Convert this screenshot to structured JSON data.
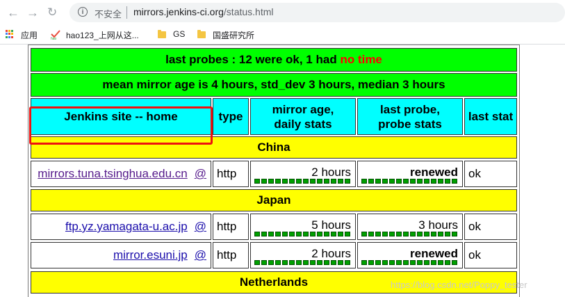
{
  "browser": {
    "insecure_label": "不安全",
    "url_host": "mirrors.jenkins-ci.org",
    "url_path": "/status.html",
    "bookmarks": [
      "应用",
      "hao123_上网从这...",
      "GS",
      "国盛研究所"
    ]
  },
  "summary": {
    "probes_prefix": "last probes : 12 were ok, 1 had ",
    "probes_highlight": "no time",
    "mean_age": "mean mirror age is 4 hours, std_dev 3 hours, median 3 hours"
  },
  "headers": {
    "site": "Jenkins site -- home",
    "type": "type",
    "age_line1": "mirror age,",
    "age_line2": "daily stats",
    "probe_line1": "last probe,",
    "probe_line2": "probe stats",
    "stat": "last stat"
  },
  "groups": {
    "china": "China",
    "japan": "Japan",
    "netherlands": "Netherlands"
  },
  "rows": [
    {
      "site": "mirrors.tuna.tsinghua.edu.cn",
      "at": "@",
      "type": "http",
      "age": "2 hours",
      "probe": "renewed",
      "stat": "ok"
    },
    {
      "site": "ftp.yz.yamagata-u.ac.jp",
      "at": "@",
      "type": "http",
      "age": "5 hours",
      "probe": "3 hours",
      "stat": "ok"
    },
    {
      "site": "mirror.esuni.jp",
      "at": "@",
      "type": "http",
      "age": "2 hours",
      "probe": "renewed",
      "stat": "ok"
    }
  ],
  "watermark": "https://blog.csdn.net/Poppy_tester",
  "colors": {
    "green": "#00ff00",
    "cyan": "#00ffff",
    "yellow": "#ffff00",
    "highlight": "#ee1111"
  }
}
